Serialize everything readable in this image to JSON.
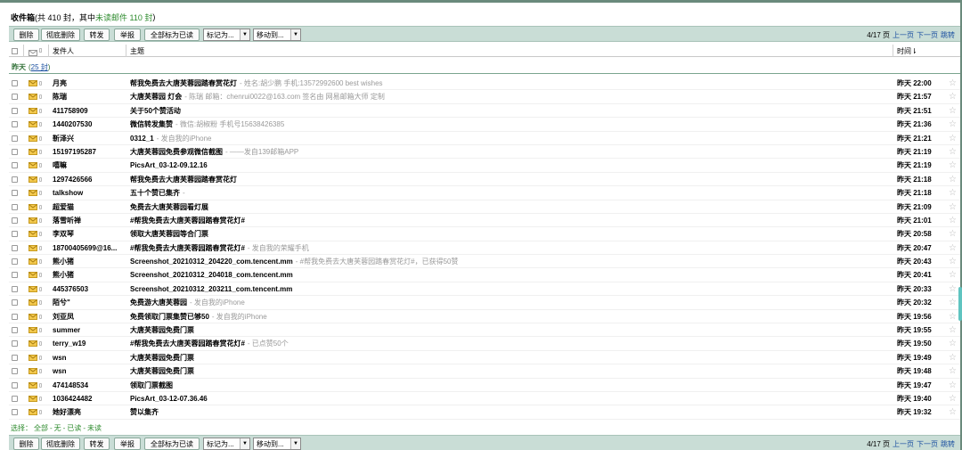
{
  "title": {
    "folder": "收件箱",
    "prefix": "(共 410 封，其中 ",
    "unread": "未读邮件 110 封",
    "suffix": ")"
  },
  "toolbar": {
    "delete": "删除",
    "perm_delete": "彻底删除",
    "forward": "转发",
    "report": "举报",
    "mark_all_read": "全部标为已读",
    "mark_as": "标记为...",
    "move_to": "移动到...",
    "page_info": "4/17 页",
    "prev": "上一页",
    "next": "下一页",
    "jump": "跳转"
  },
  "columns": {
    "sender": "发件人",
    "subject": "主题",
    "time": "时间",
    "time_sort": "⇂"
  },
  "group": {
    "label": "昨天",
    "count_open": "(",
    "count": "25 封",
    "count_close": ")"
  },
  "emails": [
    {
      "sender": "月亮",
      "subject": "帮我免费去大唐芙蓉园踏春赏花灯",
      "preview": "- 姓名:胡少鹏 手机:13572992600 best wishes",
      "time": "昨天 22:00"
    },
    {
      "sender": "陈瑞",
      "subject": "大唐芙蓉园 灯会",
      "preview": "- 陈瑞 邮箱：chenrui0022@163.com 签名由 网易邮箱大师 定制",
      "time": "昨天 21:57"
    },
    {
      "sender": "411758909",
      "subject": "关于50个赞活动",
      "preview": "",
      "time": "昨天 21:51"
    },
    {
      "sender": "1440207530",
      "subject": "微信转发集赞",
      "preview": "- 微信:胡椒粉 手机号15638426385",
      "time": "昨天 21:36"
    },
    {
      "sender": "靳泽兴",
      "subject": "0312_1",
      "preview": "- 发自我的iPhone",
      "time": "昨天 21:21"
    },
    {
      "sender": "15197195287",
      "subject": "大唐芙蓉园免费参观微信截图",
      "preview": "- ——发自139邮箱APP",
      "time": "昨天 21:19"
    },
    {
      "sender": "嘻嘛",
      "subject": "PicsArt_03-12-09.12.16",
      "preview": "",
      "time": "昨天 21:19"
    },
    {
      "sender": "1297426566",
      "subject": "帮我免费去大唐芙蓉园踏春赏花灯",
      "preview": "",
      "time": "昨天 21:18"
    },
    {
      "sender": "talkshow",
      "subject": "五十个赞已集齐",
      "preview": "-",
      "time": "昨天 21:18"
    },
    {
      "sender": "超爱猫",
      "subject": "免费去大唐芙蓉园看灯展",
      "preview": "",
      "time": "昨天 21:09"
    },
    {
      "sender": "落雪听禅",
      "subject": "#帮我免费去大唐芙蓉园踏春赏花灯#",
      "preview": "",
      "time": "昨天 21:01"
    },
    {
      "sender": "李双琴",
      "subject": "领取大唐芙蓉园等合门票",
      "preview": "",
      "time": "昨天 20:58"
    },
    {
      "sender": "18700405699@16...",
      "subject": "#帮我免费去大唐芙蓉园踏春赏花灯#",
      "preview": "- 发自我的荣耀手机",
      "time": "昨天 20:47"
    },
    {
      "sender": "熊小猪",
      "subject": "Screenshot_20210312_204220_com.tencent.mm",
      "preview": "- #帮我免费去大唐芙蓉园踏春赏花灯#，已获得50赞",
      "time": "昨天 20:43"
    },
    {
      "sender": "熊小猪",
      "subject": "Screenshot_20210312_204018_com.tencent.mm",
      "preview": "",
      "time": "昨天 20:41"
    },
    {
      "sender": "445376503",
      "subject": "Screenshot_20210312_203211_com.tencent.mm",
      "preview": "",
      "time": "昨天 20:33"
    },
    {
      "sender": "陌兮\"",
      "subject": "免费游大唐芙蓉园",
      "preview": "- 发自我的iPhone",
      "time": "昨天 20:32"
    },
    {
      "sender": "刘亚凤",
      "subject": "免费领取门票集赞已够50",
      "preview": "- 发自我的iPhone",
      "time": "昨天 19:56"
    },
    {
      "sender": "summer",
      "subject": "大唐芙蓉园免费门票",
      "preview": "",
      "time": "昨天 19:55"
    },
    {
      "sender": "terry_w19",
      "subject": "#帮我免费去大唐芙蓉园踏春赏花灯#",
      "preview": "- 已点赞50个",
      "time": "昨天 19:50"
    },
    {
      "sender": "wsn",
      "subject": "大唐芙蓉园免费门票",
      "preview": "",
      "time": "昨天 19:49"
    },
    {
      "sender": "wsn",
      "subject": "大唐芙蓉园免费门票",
      "preview": "",
      "time": "昨天 19:48"
    },
    {
      "sender": "474148534",
      "subject": "领取门票截图",
      "preview": "",
      "time": "昨天 19:47"
    },
    {
      "sender": "1036424482",
      "subject": "PicsArt_03-12-07.36.46",
      "preview": "",
      "time": "昨天 19:40"
    },
    {
      "sender": "她好漂亮",
      "subject": "赞以集齐",
      "preview": "",
      "time": "昨天 19:32"
    }
  ],
  "select_bar": {
    "label": "选择：",
    "all": "全部",
    "none": "无",
    "read": "已读",
    "unread": "未读",
    "sep": "-"
  },
  "icons": {
    "unread_mail": "envelope-icon",
    "attachment": "attachment-icon",
    "star": "star-icon"
  },
  "colors": {
    "toolbar_bg": "#c9ddd6",
    "group_green": "#2f6f35",
    "unread_green": "#2e8b2e",
    "link_blue": "#1a4fa0"
  }
}
